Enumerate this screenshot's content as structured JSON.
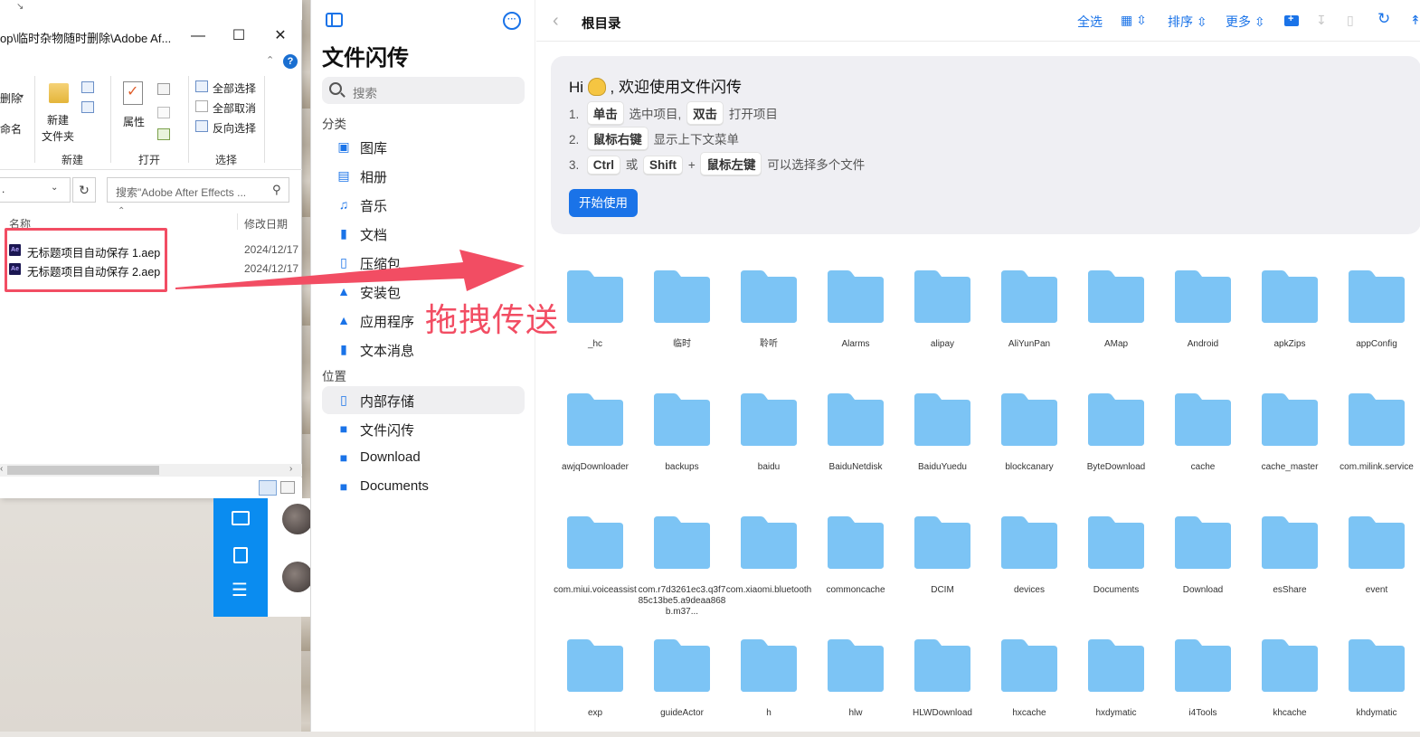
{
  "explorer": {
    "title_path": "op\\临时杂物随时删除\\Adobe Af...",
    "ribbon": {
      "delete": "删除",
      "rename": "重命名",
      "new_folder_line1": "新建",
      "new_folder_line2": "文件夹",
      "properties": "属性",
      "select_all": "全部选择",
      "select_none": "全部取消",
      "invert_select": "反向选择",
      "group_new": "新建",
      "group_open": "打开",
      "group_select": "选择"
    },
    "address_value": ".",
    "search_placeholder": "搜索\"Adobe After Effects ...",
    "col_name": "名称",
    "col_date": "修改日期",
    "files": [
      {
        "name": "无标题项目自动保存 1.aep",
        "date": "2024/12/17"
      },
      {
        "name": "无标题项目自动保存 2.aep",
        "date": "2024/12/17"
      }
    ]
  },
  "annotation": {
    "drag_text": "拖拽传送"
  },
  "sidebar": {
    "app_title": "文件闪传",
    "search_placeholder": "搜索",
    "section_category": "分类",
    "categories": [
      {
        "label": "图库",
        "icon": "image-icon"
      },
      {
        "label": "相册",
        "icon": "album-icon"
      },
      {
        "label": "音乐",
        "icon": "music-icon"
      },
      {
        "label": "文档",
        "icon": "document-icon"
      },
      {
        "label": "压缩包",
        "icon": "archive-icon"
      },
      {
        "label": "安装包",
        "icon": "android-icon"
      },
      {
        "label": "应用程序",
        "icon": "app-store-icon"
      },
      {
        "label": "文本消息",
        "icon": "clipboard-icon"
      }
    ],
    "section_location": "位置",
    "locations": [
      {
        "label": "内部存储",
        "icon": "phone-icon",
        "active": true
      },
      {
        "label": "文件闪传",
        "icon": "folder-icon"
      },
      {
        "label": "Download",
        "icon": "folder-icon"
      },
      {
        "label": "Documents",
        "icon": "folder-icon"
      }
    ]
  },
  "toolbar": {
    "title": "根目录",
    "select_all": "全选",
    "sort": "排序",
    "more": "更多"
  },
  "welcome": {
    "hi_prefix": "Hi",
    "hi_text": ", 欢迎使用文件闪传",
    "line1_num": "1.",
    "line1_key1": "单击",
    "line1_text1": "选中项目,",
    "line1_key2": "双击",
    "line1_text2": "打开项目",
    "line2_num": "2.",
    "line2_key": "鼠标右键",
    "line2_text": "显示上下文菜单",
    "line3_num": "3.",
    "line3_key1": "Ctrl",
    "line3_or": "或",
    "line3_key2": "Shift",
    "line3_plus": "+",
    "line3_key3": "鼠标左键",
    "line3_text": "可以选择多个文件",
    "start_button": "开始使用"
  },
  "folders": [
    "_hc",
    "临时",
    "聆听",
    "Alarms",
    "alipay",
    "AliYunPan",
    "AMap",
    "Android",
    "apkZips",
    "appConfig",
    "awjqDownloader",
    "backups",
    "baidu",
    "BaiduNetdisk",
    "BaiduYuedu",
    "blockcanary",
    "ByteDownload",
    "cache",
    "cache_master",
    "com.milink.service",
    "com.miui.voiceassist",
    "com.r7d3261ec3.q3f785c13be5.a9deaa868b.m37...",
    "com.xiaomi.bluetooth",
    "commoncache",
    "DCIM",
    "devices",
    "Documents",
    "Download",
    "esShare",
    "event",
    "exp",
    "guideActor",
    "h",
    "hlw",
    "HLWDownload",
    "hxcache",
    "hxdymatic",
    "i4Tools",
    "khcache",
    "khdymatic"
  ],
  "colors": {
    "accent": "#1a73e8",
    "folder": "#7cc4f4",
    "annotation": "#f24d63",
    "phone_bar": "#0a8cf0"
  }
}
